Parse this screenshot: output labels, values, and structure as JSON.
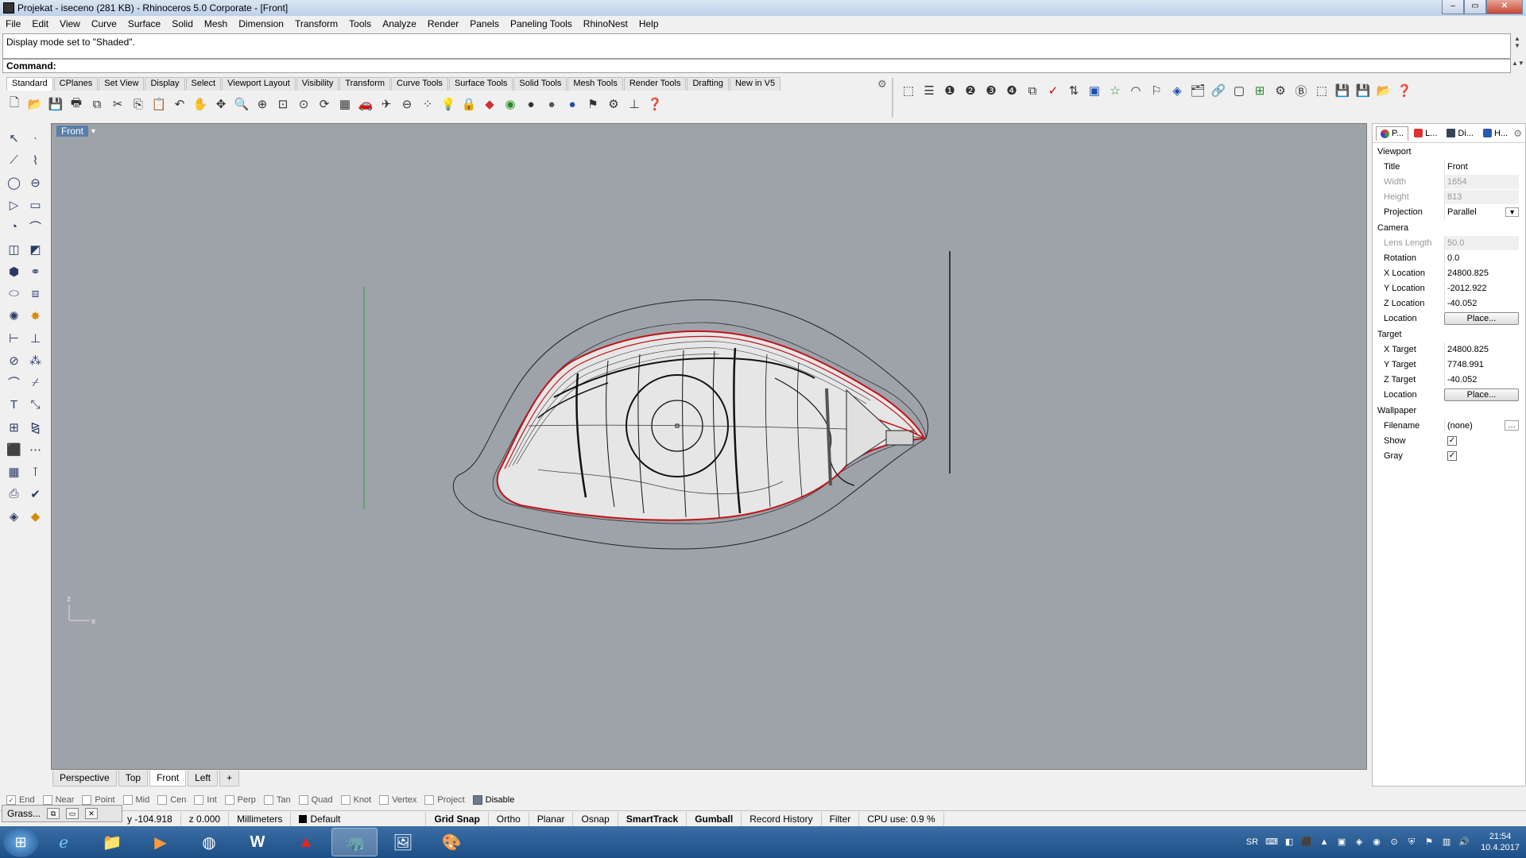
{
  "window": {
    "title": "Projekat - iseceno (281 KB) - Rhinoceros  5.0 Corporate - [Front]",
    "buttons": {
      "minimize": "‒",
      "maximize": "▭",
      "close": "✕"
    }
  },
  "menu": [
    "File",
    "Edit",
    "View",
    "Curve",
    "Surface",
    "Solid",
    "Mesh",
    "Dimension",
    "Transform",
    "Tools",
    "Analyze",
    "Render",
    "Panels",
    "Paneling Tools",
    "RhinoNest",
    "Help"
  ],
  "command": {
    "history": "Display mode set to \"Shaded\".",
    "prompt": "Command:"
  },
  "toolbar_tabs": [
    "Standard",
    "CPlanes",
    "Set View",
    "Display",
    "Select",
    "Viewport Layout",
    "Visibility",
    "Transform",
    "Curve Tools",
    "Surface Tools",
    "Solid Tools",
    "Mesh Tools",
    "Render Tools",
    "Drafting",
    "New in V5"
  ],
  "viewport": {
    "name": "Front",
    "axis_z": "z",
    "axis_x": "x"
  },
  "viewport_tabs": [
    "Perspective",
    "Top",
    "Front",
    "Left"
  ],
  "viewport_tab_add": "+",
  "properties": {
    "tabs": [
      "P...",
      "L...",
      "Di...",
      "H..."
    ],
    "viewport_section": "Viewport",
    "title_label": "Title",
    "title_value": "Front",
    "width_label": "Width",
    "width_value": "1654",
    "height_label": "Height",
    "height_value": "813",
    "projection_label": "Projection",
    "projection_value": "Parallel",
    "camera_section": "Camera",
    "lens_label": "Lens Length",
    "lens_value": "50.0",
    "rotation_label": "Rotation",
    "rotation_value": "0.0",
    "cxloc_label": "X Location",
    "cxloc_value": "24800.825",
    "cyloc_label": "Y Location",
    "cyloc_value": "-2012.922",
    "czloc_label": "Z Location",
    "czloc_value": "-40.052",
    "cloc_label": "Location",
    "place_button": "Place...",
    "target_section": "Target",
    "txt_label": "X Target",
    "txt_value": "24800.825",
    "tyt_label": "Y Target",
    "tyt_value": "7748.991",
    "tzt_label": "Z Target",
    "tzt_value": "-40.052",
    "tloc_label": "Location",
    "wallpaper_section": "Wallpaper",
    "filename_label": "Filename",
    "filename_value": "(none)",
    "show_label": "Show",
    "gray_label": "Gray"
  },
  "osnap": [
    "End",
    "Near",
    "Point",
    "Mid",
    "Cen",
    "Int",
    "Perp",
    "Tan",
    "Quad",
    "Knot",
    "Vertex",
    "Project",
    "Disable"
  ],
  "grasshopper": {
    "label": "Grass..."
  },
  "status": {
    "y": "y -104.918",
    "z": "z 0.000",
    "units": "Millimeters",
    "layer": "Default",
    "grid_snap": "Grid Snap",
    "ortho": "Ortho",
    "planar": "Planar",
    "osnap": "Osnap",
    "smarttrack": "SmartTrack",
    "gumball": "Gumball",
    "record_history": "Record History",
    "filter": "Filter",
    "cpu": "CPU use: 0.9 %"
  },
  "tray": {
    "lang": "SR",
    "time": "21:54",
    "date": "10.4.2017"
  },
  "colors": {
    "viewport_bg": "#9ea3aa",
    "curve_red": "#c0141a",
    "axis_green": "#2fa12f"
  }
}
